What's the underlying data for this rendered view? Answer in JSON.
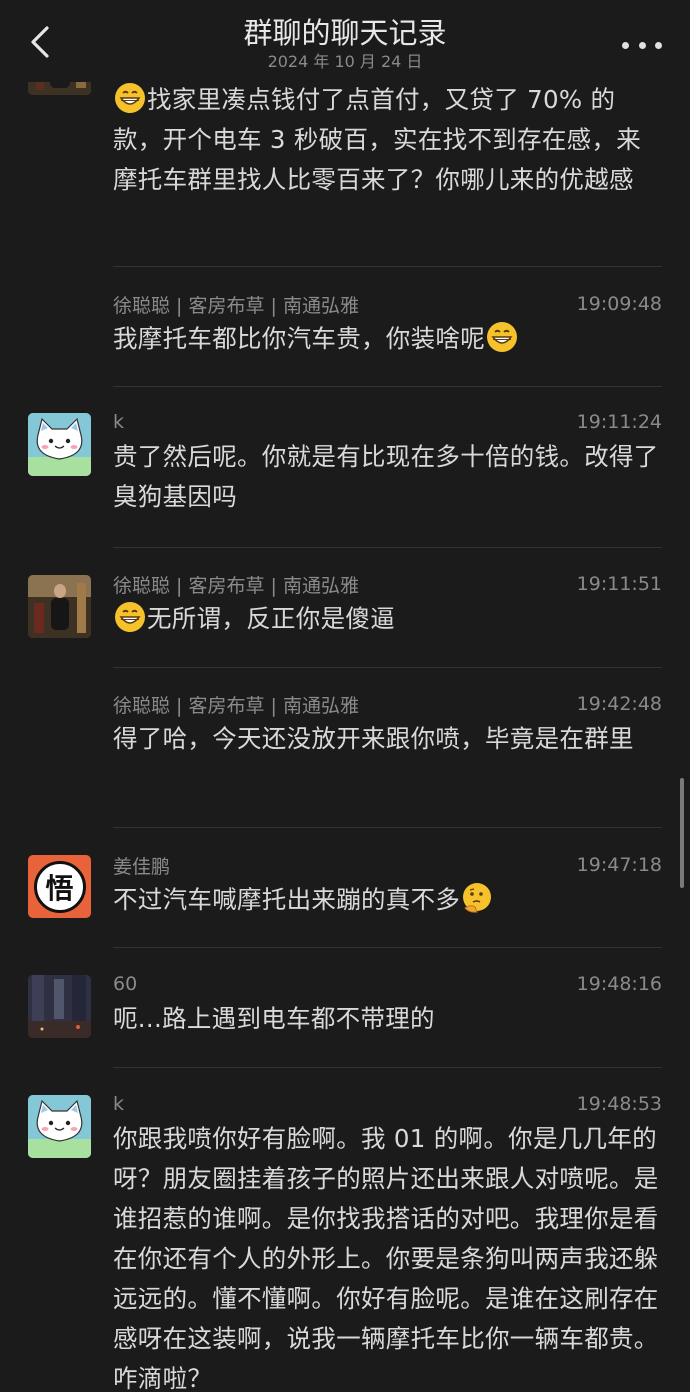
{
  "header": {
    "title": "群聊的聊天记录",
    "date": "2024 年 10 月 24 日"
  },
  "messages": [
    {
      "name": "",
      "time": "",
      "avatar": "photo",
      "text": "找家里凑点钱付了点首付，又贷了 70% 的款，开个电车 3 秒破百，实在找不到存在感，来摩托车群里找人比零百来了？你哪儿来的优越感"
    },
    {
      "name": "徐聪聪 | 客房布草 | 南通弘雅",
      "time": "19:09:48",
      "avatar": "",
      "text": "我摩托车都比你汽车贵，你装啥呢"
    },
    {
      "name": "k",
      "time": "19:11:24",
      "avatar": "cat",
      "text": "贵了然后呢。你就是有比现在多十倍的钱。改得了臭狗基因吗"
    },
    {
      "name": "徐聪聪 | 客房布草 | 南通弘雅",
      "time": "19:11:51",
      "avatar": "photo",
      "text": "无所谓，反正你是傻逼"
    },
    {
      "name": "徐聪聪 | 客房布草 | 南通弘雅",
      "time": "19:42:48",
      "avatar": "",
      "text": "得了哈，今天还没放开来跟你喷，毕竟是在群里"
    },
    {
      "name": "姜佳鹏",
      "time": "19:47:18",
      "avatar": "wu",
      "avatar_char": "悟",
      "text": "不过汽车喊摩托出来蹦的真不多"
    },
    {
      "name": "60",
      "time": "19:48:16",
      "avatar": "street",
      "text": "呃...路上遇到电车都不带理的"
    },
    {
      "name": "k",
      "time": "19:48:53",
      "avatar": "cat",
      "text": "你跟我喷你好有脸啊。我 01 的啊。你是几几年的呀？朋友圈挂着孩子的照片还出来跟人对喷呢。是谁招惹的谁啊。是你找我搭话的对吧。我理你是看在你还有个人的外形上。你要是条狗叫两声我还躲远远的。懂不懂啊。你好有脸呢。是谁在这刷存在感呀在这装啊，说我一辆摩托车比你一辆车都贵。咋滴啦？"
    }
  ],
  "icons": {
    "back": "back-chevron-icon",
    "more": "more-dots-icon",
    "grin": "grinning-emoji-icon",
    "thinking": "thinking-emoji-icon"
  },
  "colors": {
    "background": "#1b1b1b",
    "text": "#d9d9d9",
    "meta": "#8a8a8a",
    "divider": "#333333"
  }
}
